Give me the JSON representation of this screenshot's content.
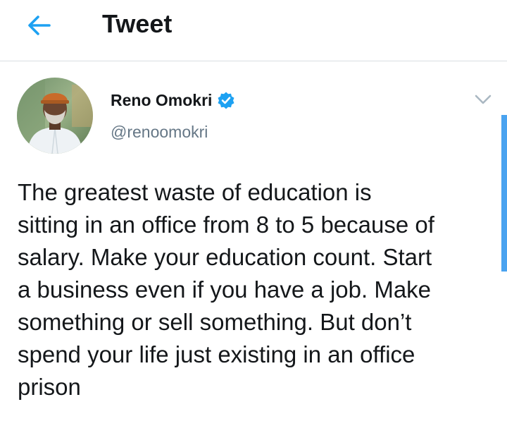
{
  "header": {
    "title": "Tweet",
    "back_icon": "arrow-left-icon",
    "accent_color": "#1da1f2"
  },
  "tweet": {
    "author": {
      "display_name": "Reno Omokri",
      "handle": "@renoomokri",
      "verified": true,
      "verified_icon": "verified-badge-icon"
    },
    "text": "The greatest waste of education is\nsitting in an office from 8 to 5 because of\nsalary. Make your education count. Start\na business even if you have a job. Make\nsomething or sell something. But don’t\nspend your life just existing in an office\nprison",
    "menu_icon": "chevron-down-icon"
  }
}
